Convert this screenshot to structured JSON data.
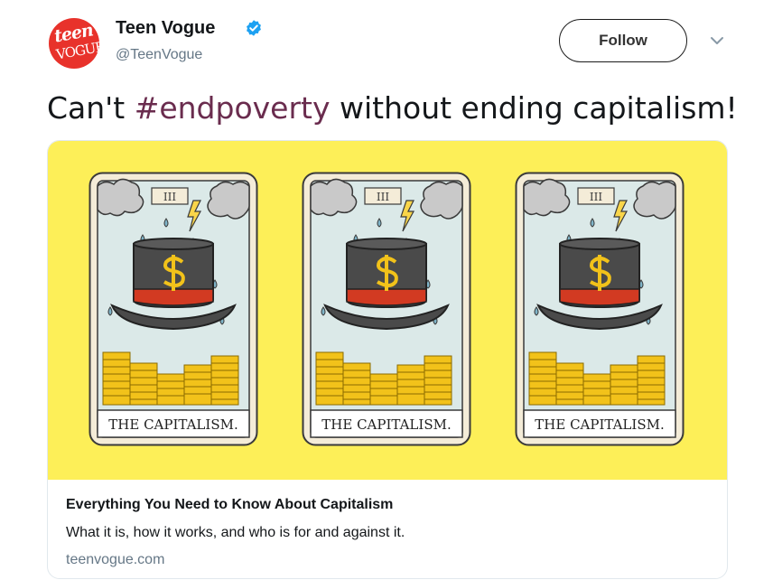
{
  "author": {
    "display_name": "Teen Vogue",
    "handle": "@TeenVogue",
    "avatar_line1": "teen",
    "avatar_line2": "VOGUE",
    "verified_icon": "verified-badge-icon"
  },
  "actions": {
    "follow_label": "Follow",
    "menu_icon": "chevron-down-icon"
  },
  "tweet": {
    "text_before": "Can't ",
    "hashtag": "#endpoverty",
    "text_after": " without ending capitalism!"
  },
  "card": {
    "tarot_numeral": "III",
    "tarot_caption": "THE CAPITALISM.",
    "title": "Everything You Need to Know About Capitalism",
    "description": "What it is, how it works, and who is for and against it.",
    "domain": "teenvogue.com"
  },
  "colors": {
    "brand_red": "#e8322b",
    "verified_blue": "#1da1f2",
    "hashtag": "#6a2c4e",
    "card_bg_yellow": "#fdef58",
    "coin_gold": "#f2c21a",
    "hat_band": "#d23a22"
  }
}
